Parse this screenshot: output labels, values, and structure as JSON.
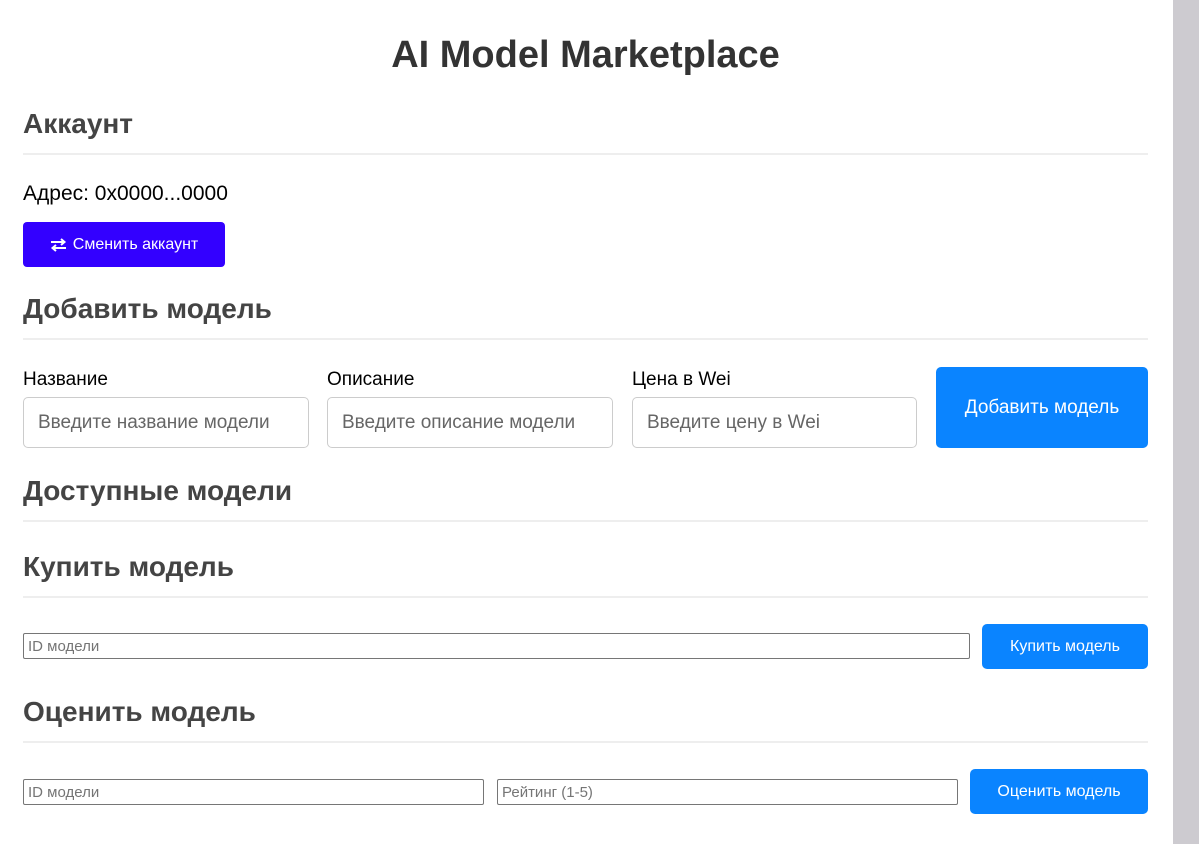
{
  "page": {
    "title": "AI Model Marketplace"
  },
  "account": {
    "heading": "Аккаунт",
    "address_label": "Адрес: 0x0000...0000",
    "switch_button": "Сменить аккаунт",
    "switch_icon": "swap-arrows-icon",
    "switch_button_color": "#3300ff"
  },
  "add_model": {
    "heading": "Добавить модель",
    "name": {
      "label": "Название",
      "placeholder": "Введите название модели"
    },
    "description": {
      "label": "Описание",
      "placeholder": "Введите описание модели"
    },
    "price": {
      "label": "Цена в Wei",
      "placeholder": "Введите цену в Wei"
    },
    "submit_button": "Добавить модель"
  },
  "available_models": {
    "heading": "Доступные модели"
  },
  "buy_model": {
    "heading": "Купить модель",
    "id_placeholder": "ID модели",
    "submit_button": "Купить модель"
  },
  "rate_model": {
    "heading": "Оценить модель",
    "id_placeholder": "ID модели",
    "rating_placeholder": "Рейтинг (1-5)",
    "submit_button": "Оценить модель"
  },
  "colors": {
    "primary_button": "#0a84ff",
    "accent_button": "#3300ff",
    "heading_text": "#444444"
  }
}
